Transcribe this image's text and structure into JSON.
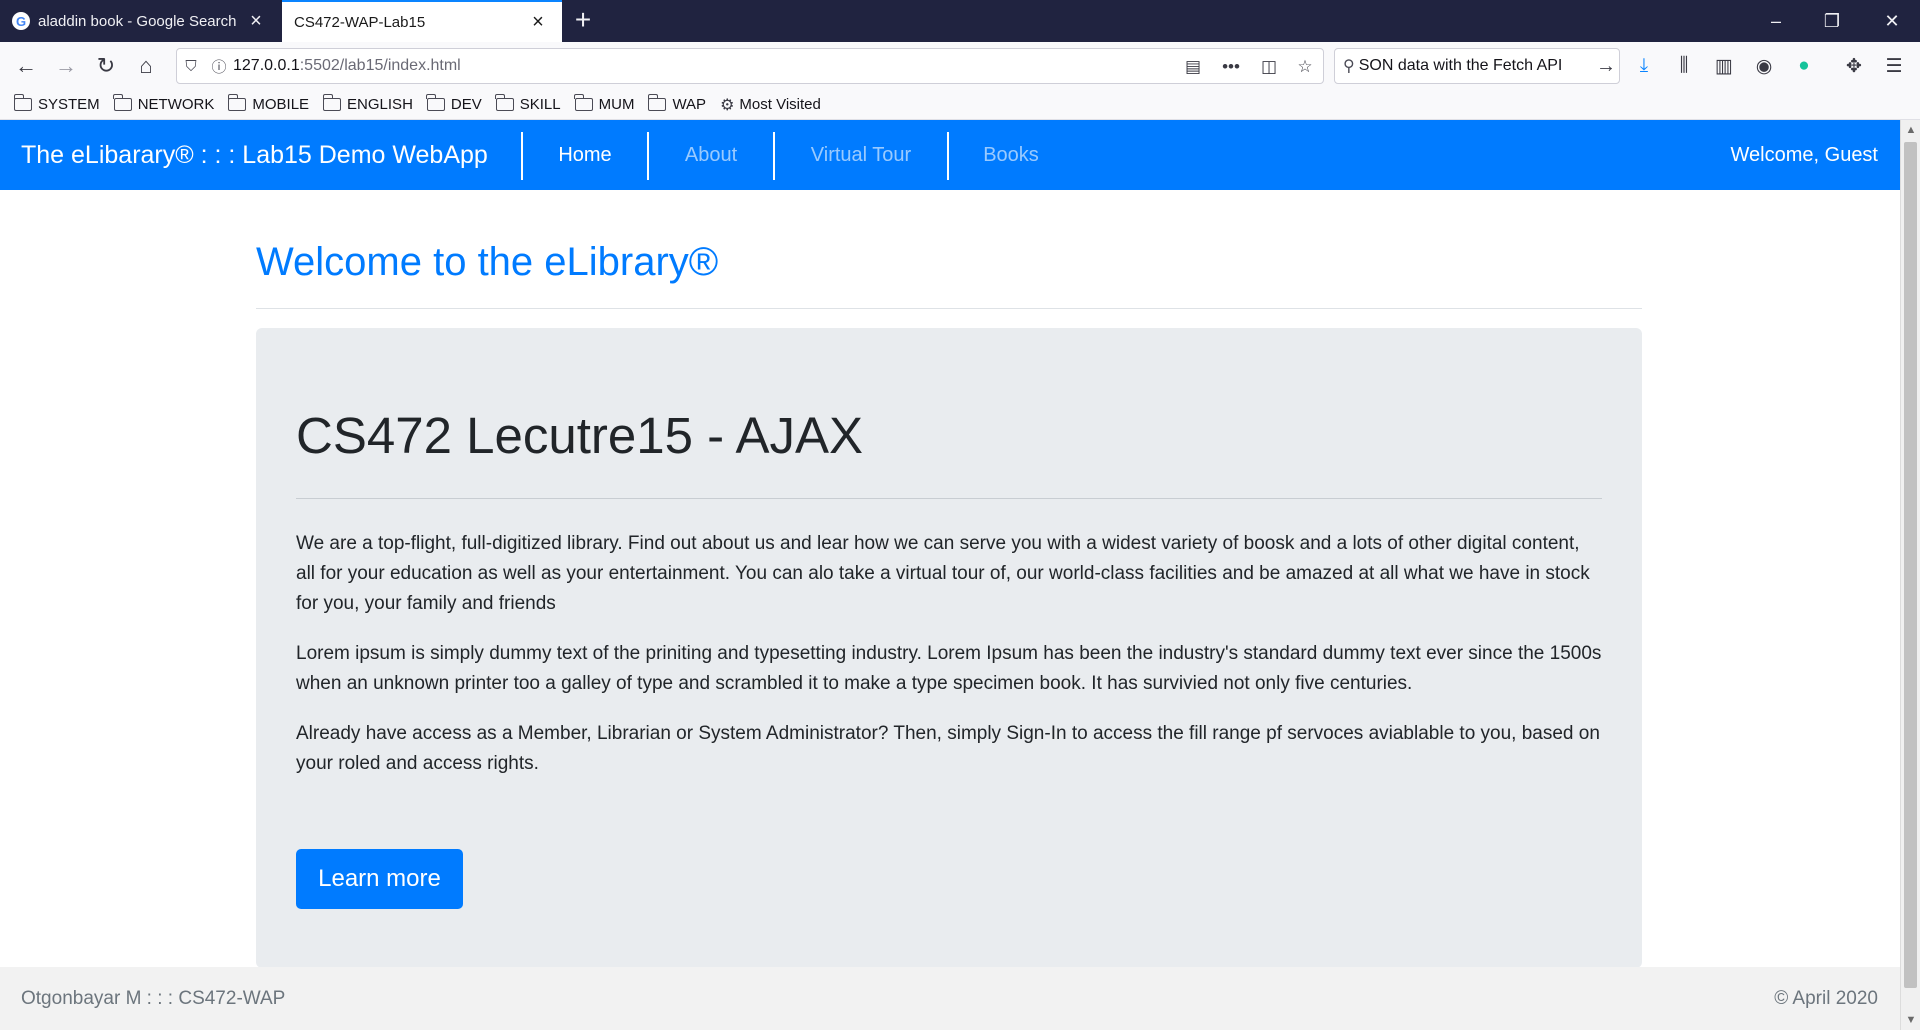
{
  "browser": {
    "tabs": [
      {
        "title": "aladdin book - Google Search",
        "favicon": "G"
      },
      {
        "title": "CS472-WAP-Lab15"
      }
    ],
    "url": {
      "host": "127.0.0.1",
      "path": ":5502/lab15/index.html"
    },
    "search_text": "SON data with the Fetch API",
    "bookmarks": [
      "SYSTEM",
      "NETWORK",
      "MOBILE",
      "ENGLISH",
      "DEV",
      "SKILL",
      "MUM",
      "WAP",
      "Most Visited"
    ],
    "accent_color": "#0a84ff"
  },
  "app": {
    "brand": "The eLibarary® : : : Lab15 Demo WebApp",
    "nav": [
      "Home",
      "About",
      "Virtual Tour",
      "Books"
    ],
    "active_nav": "Home",
    "welcome": "Welcome, Guest",
    "primary_color": "#007bff"
  },
  "main": {
    "page_title": "Welcome to the eLibrary®",
    "heading": "CS472 Lecutre15 - AJAX",
    "paragraphs": [
      "We are a top-flight, full-digitized library. Find out about us and lear how we can serve you with a widest variety of boosk and a lots of other digital content, all for your education as well as your entertainment. You can alo take a virtual tour of, our world-class facilities and be amazed at all what we have in stock for you, your family and friends",
      "Lorem ipsum is simply dummy text of the priniting and typesetting industry. Lorem Ipsum has been the industry's standard dummy text ever since the 1500s when an unknown printer too a galley of type and scrambled it to make a type specimen book. It has survivied not only five centuries.",
      "Already have access as a Member, Librarian or System Administrator? Then, simply Sign-In to access the fill range pf servoces aviablable to you, based on your roled and access rights."
    ],
    "button_label": "Learn more"
  },
  "footer": {
    "left": "Otgonbayar M : : : CS472-WAP",
    "right": "© April 2020"
  }
}
